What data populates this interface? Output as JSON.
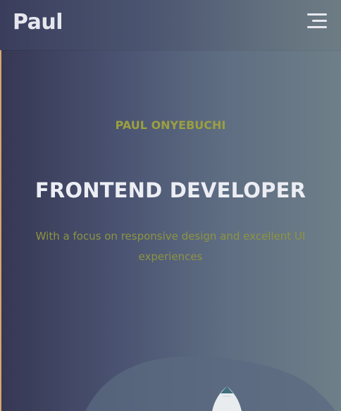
{
  "navbar": {
    "brand": "Paul",
    "menu_icon": "hamburger-menu-icon"
  },
  "hero": {
    "eyebrow": "PAUL ONYEBUCHI",
    "headline": "FRONTEND DEVELOPER",
    "tagline": "With a focus on responsive design and excellent UI experiences"
  },
  "colors": {
    "accent": "#9ca03e",
    "headline": "#eceef4",
    "gradient_start": "#363753",
    "gradient_end": "#6e7f88",
    "left_edge": "#d9a66c"
  },
  "illustration": {
    "icon": "rocket-illustration"
  }
}
